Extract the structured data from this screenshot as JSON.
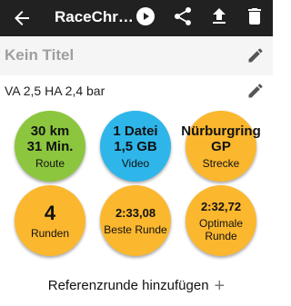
{
  "appbar": {
    "title": "RaceChr…",
    "icons": [
      "arrow-back-icon",
      "play-circle-icon",
      "share-icon",
      "upload-icon",
      "delete-icon"
    ]
  },
  "session": {
    "title": "Kein Titel",
    "tyre_pressure": "VA 2,5 HA 2,4 bar"
  },
  "stats": [
    {
      "value_line1": "30 km",
      "value_line2": "31 Min.",
      "label": "Route",
      "color": "#8cc63e"
    },
    {
      "value_line1": "1 Datei",
      "value_line2": "1,5 GB",
      "label": "Video",
      "color": "#2eb6ea"
    },
    {
      "value_line1": "Nürburgring",
      "value_line2": "GP",
      "label": "Strecke",
      "color": "#fbb72e"
    },
    {
      "value_line1": "4",
      "value_line2": "",
      "label": "Runden",
      "color": "#fbb72e"
    },
    {
      "value_line1": "2:33,08",
      "value_line2": "",
      "label": "Beste Runde",
      "color": "#fbb72e"
    },
    {
      "value_line1": "2:32,72",
      "value_line2": "",
      "label_line1": "Optimale",
      "label_line2": "Runde",
      "color": "#fbb72e"
    }
  ],
  "actions": {
    "add_reference_lap": "Referenzrunde hinzufügen",
    "add_symbol": "+"
  }
}
